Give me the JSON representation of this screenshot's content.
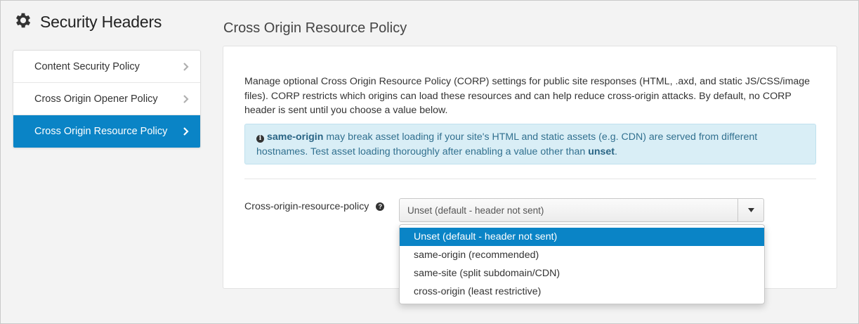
{
  "app": {
    "title": "Security Headers",
    "icon": "gear-icon"
  },
  "sidebar": {
    "items": [
      {
        "label": "Content Security Policy",
        "active": false
      },
      {
        "label": "Cross Origin Opener Policy",
        "active": false
      },
      {
        "label": "Cross Origin Resource Policy",
        "active": true
      }
    ]
  },
  "main": {
    "title": "Cross Origin Resource Policy",
    "description": "Manage optional Cross Origin Resource Policy (CORP) settings for public site responses (HTML, .axd, and static JS/CSS/image files). CORP restricts which origins can load these resources and can help reduce cross-origin attacks. By default, no CORP header is sent until you choose a value below.",
    "alert": {
      "icon": "info-icon",
      "strong1": "same-origin",
      "text1": " may break asset loading if your site's HTML and static assets (e.g. CDN) are served from different hostnames. Test asset loading thoroughly after enabling a value other than ",
      "strong2": "unset",
      "text2": "."
    },
    "field": {
      "label": "Cross-origin-resource-policy",
      "help_icon": "question-icon",
      "selected_value": "Unset (default - header not sent)",
      "options": [
        "Unset (default - header not sent)",
        "same-origin (recommended)",
        "same-site (split subdomain/CDN)",
        "cross-origin (least restrictive)"
      ]
    }
  },
  "colors": {
    "accent": "#0a84c6",
    "alert_bg": "#d9eef6",
    "alert_text": "#31708f"
  }
}
